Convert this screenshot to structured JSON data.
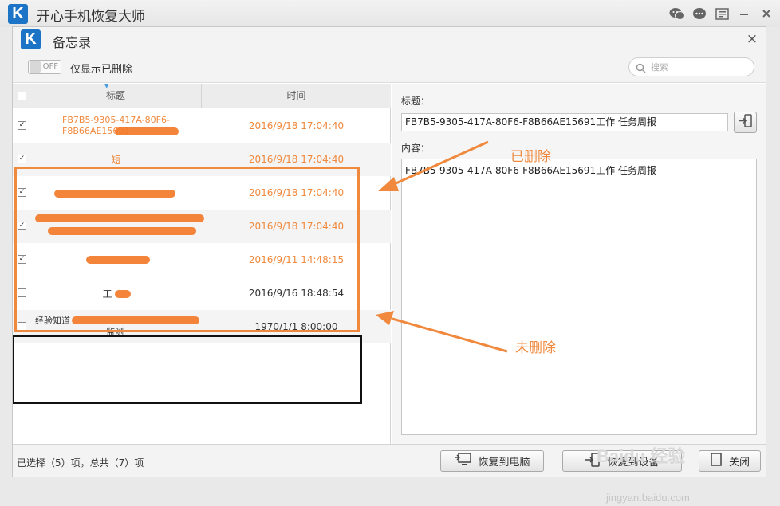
{
  "app": {
    "logo_letter": "K",
    "title": "开心手机恢复大师"
  },
  "titlebar_icons": [
    "wechat-icon",
    "chat-icon",
    "menu-list-icon",
    "minimize-icon",
    "close-icon"
  ],
  "dialog": {
    "logo_letter": "K",
    "title": "备忘录",
    "close_glyph": "×"
  },
  "toolbar": {
    "toggle_state": "OFF",
    "toggle_label": "仅显示已删除",
    "search_placeholder": "搜索"
  },
  "table": {
    "header_title": "标题",
    "header_time": "时间",
    "rows": [
      {
        "checked": true,
        "deleted": true,
        "title_line1": "FB7B5-9305-417A-80F6-",
        "title_line2": "F8B66AE15691",
        "time": "2016/9/18 17:04:40"
      },
      {
        "checked": true,
        "deleted": true,
        "title": "短",
        "time": "2016/9/18 17:04:40"
      },
      {
        "checked": true,
        "deleted": true,
        "title": "",
        "time": "2016/9/18 17:04:40"
      },
      {
        "checked": true,
        "deleted": true,
        "title": "",
        "time": "2016/9/18 17:04:40"
      },
      {
        "checked": true,
        "deleted": true,
        "title": "",
        "time": "2016/9/11 14:48:15"
      },
      {
        "checked": false,
        "deleted": false,
        "title": "工",
        "time": "2016/9/16 18:48:54"
      },
      {
        "checked": false,
        "deleted": false,
        "title_line1": "经验知道",
        "title_line2": "监测",
        "time": "1970/1/1 8:00:00"
      }
    ]
  },
  "detail": {
    "title_label": "标题：",
    "title_value": "FB7B5-9305-417A-80F6-F8B66AE15691工作 任务周报",
    "content_label": "内容：",
    "content_value": "FB7B5-9305-417A-80F6-F8B66AE15691工作 任务周报"
  },
  "footer": {
    "selection_info": "已选择（5）项，总共（7）项",
    "restore_pc_label": "恢复到电脑",
    "restore_device_label": "恢复到设备",
    "close_label": "关闭"
  },
  "annotations": {
    "deleted": "已删除",
    "not_deleted": "未删除"
  },
  "watermark": {
    "brand": "Baidu 经验",
    "url": "jingyan.baidu.com"
  },
  "colors": {
    "accent_blue": "#1b74c5",
    "deleted_orange": "#f0893d"
  }
}
